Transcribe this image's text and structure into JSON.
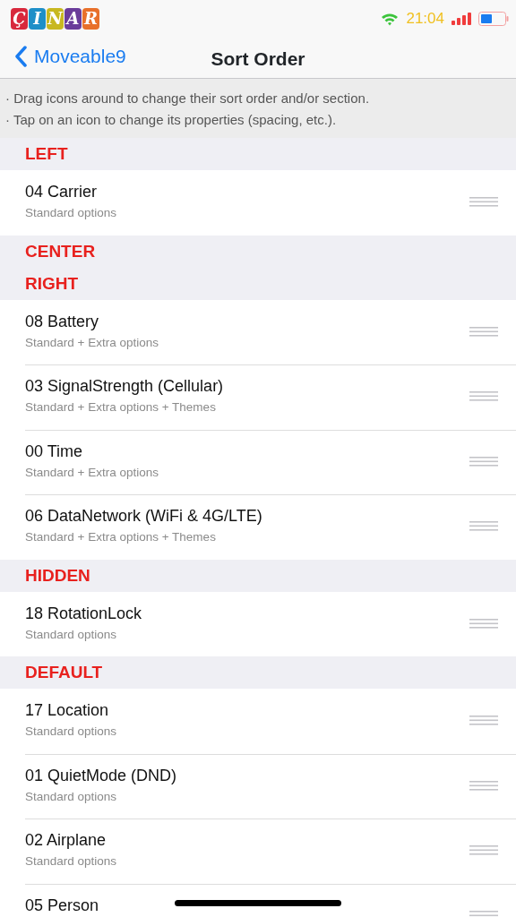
{
  "status_bar": {
    "logo": [
      {
        "char": "Ç",
        "color": "#d8283c"
      },
      {
        "char": "I",
        "color": "#1e8fc8"
      },
      {
        "char": "N",
        "color": "#c8b820"
      },
      {
        "char": "A",
        "color": "#6a3c9a"
      },
      {
        "char": "R",
        "color": "#e8702a"
      }
    ],
    "time": "21:04"
  },
  "nav": {
    "back": "Moveable9",
    "title": "Sort Order"
  },
  "instructions": [
    "· Drag icons around to change their sort order and/or section.",
    "· Tap on an icon to change its properties (spacing, etc.)."
  ],
  "sections": [
    {
      "title": "LEFT",
      "items": [
        {
          "name": "04 Carrier",
          "detail": "Standard options"
        }
      ]
    },
    {
      "title": "CENTER"
    },
    {
      "title": "RIGHT",
      "items": [
        {
          "name": "08 Battery",
          "detail": "Standard + Extra options"
        },
        {
          "name": "03 SignalStrength (Cellular)",
          "detail": "Standard + Extra options + Themes"
        },
        {
          "name": "00 Time",
          "detail": "Standard + Extra options"
        },
        {
          "name": "06 DataNetwork (WiFi & 4G/LTE)",
          "detail": "Standard + Extra options + Themes"
        }
      ]
    },
    {
      "title": "HIDDEN",
      "items": [
        {
          "name": "18 RotationLock",
          "detail": "Standard options"
        }
      ]
    },
    {
      "title": "DEFAULT",
      "items": [
        {
          "name": "17 Location",
          "detail": "Standard options"
        },
        {
          "name": "01 QuietMode (DND)",
          "detail": "Standard options"
        },
        {
          "name": "02 Airplane",
          "detail": "Standard options"
        },
        {
          "name": "05 Person"
        }
      ]
    }
  ]
}
